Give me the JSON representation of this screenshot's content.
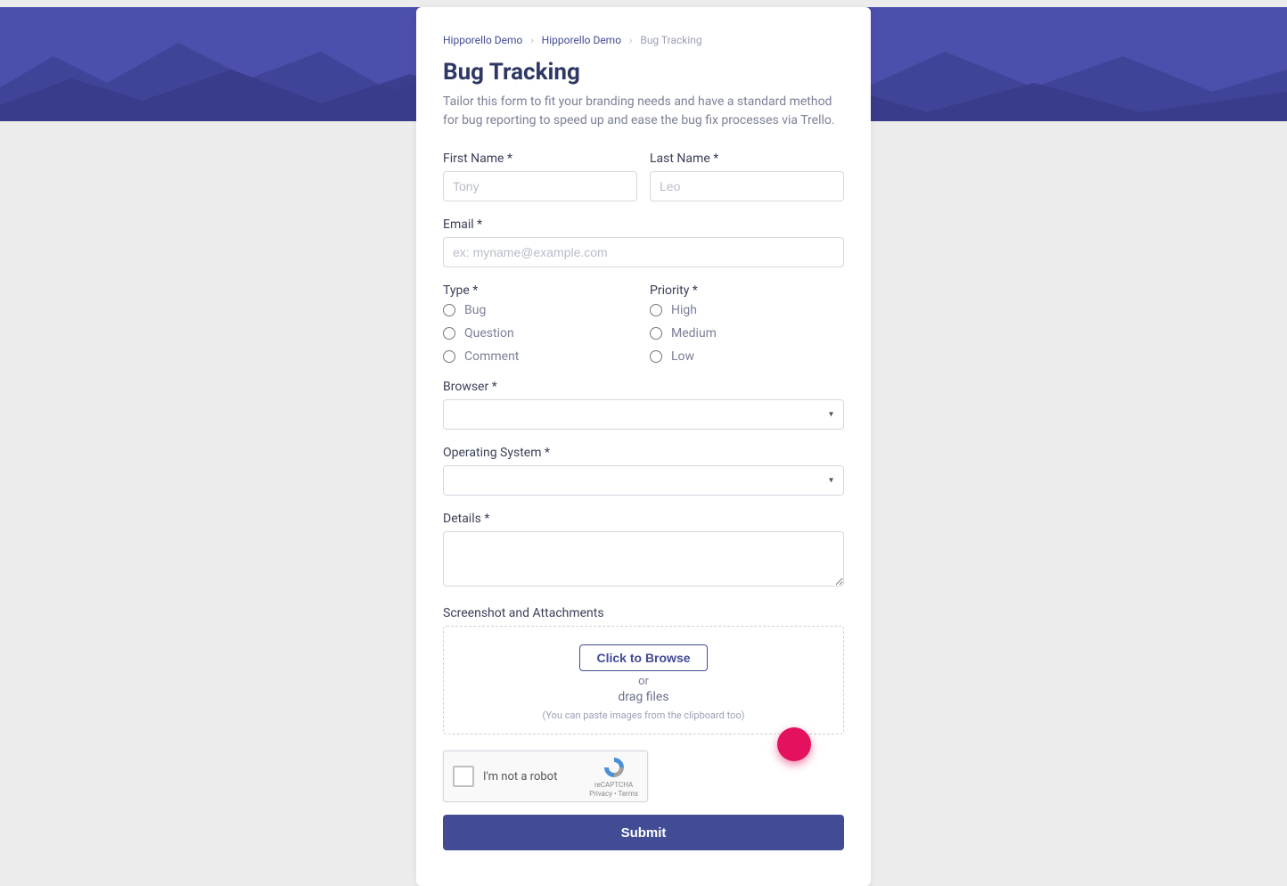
{
  "breadcrumbs": {
    "items": [
      "Hipporello Demo",
      "Hipporello Demo",
      "Bug Tracking"
    ]
  },
  "page": {
    "title": "Bug Tracking",
    "description": "Tailor this form to fit your branding needs and have a standard method for bug reporting to speed up and ease the bug fix processes via Trello."
  },
  "form": {
    "first_name": {
      "label": "First Name *",
      "placeholder": "Tony"
    },
    "last_name": {
      "label": "Last Name *",
      "placeholder": "Leo"
    },
    "email": {
      "label": "Email *",
      "placeholder": "ex: myname@example.com"
    },
    "type": {
      "label": "Type *",
      "options": [
        "Bug",
        "Question",
        "Comment"
      ]
    },
    "priority": {
      "label": "Priority *",
      "options": [
        "High",
        "Medium",
        "Low"
      ]
    },
    "browser": {
      "label": "Browser *"
    },
    "os": {
      "label": "Operating System *"
    },
    "details": {
      "label": "Details *"
    },
    "attachments": {
      "label": "Screenshot and Attachments",
      "browse": "Click to Browse",
      "or": "or",
      "drag": "drag files",
      "hint": "(You can paste images from the clipboard too)"
    },
    "recaptcha": {
      "text": "I'm not a robot",
      "brand": "reCAPTCHA",
      "terms": "Privacy • Terms"
    },
    "submit": "Submit"
  }
}
